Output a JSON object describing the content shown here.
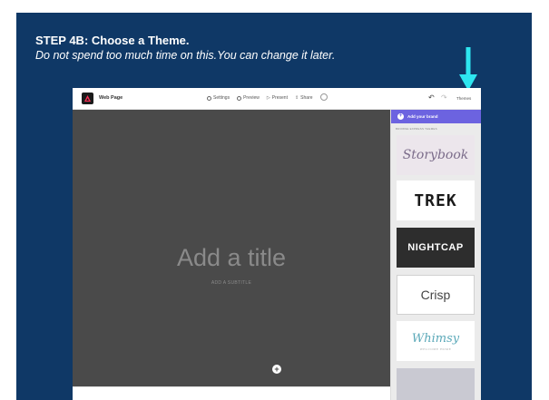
{
  "slide": {
    "step_title": "STEP 4B: Choose a Theme.",
    "step_subtitle": "Do not spend too much time on this.You can change it later."
  },
  "colors": {
    "slide_bg": "#0f3866",
    "arrow": "#2ee6f0",
    "brand_bar": "#6c63e0",
    "canvas_bg": "#4a4a4a"
  },
  "app": {
    "doc_name": "Web Page",
    "menu": [
      {
        "label": "Settings",
        "icon": "gear-icon"
      },
      {
        "label": "Preview",
        "icon": "eye-icon"
      },
      {
        "label": "Present",
        "icon": "play-icon"
      },
      {
        "label": "Share",
        "icon": "share-icon"
      }
    ],
    "undo_icon": "↶",
    "redo_icon": "↷",
    "themes_label": "Themes"
  },
  "canvas": {
    "title_placeholder": "Add a title",
    "subtitle_placeholder": "ADD A SUBTITLE",
    "add_symbol": "+"
  },
  "panel": {
    "brand_icon": "+",
    "brand_label": "Add your brand",
    "section_label": "BROWSE EXPRESS THEMES",
    "themes": [
      {
        "name": "Storybook"
      },
      {
        "name": "TREK"
      },
      {
        "name": "NIGHTCAP"
      },
      {
        "name": "Crisp"
      },
      {
        "name": "Whimsy",
        "tagline": "WELCOME HOME"
      }
    ]
  }
}
